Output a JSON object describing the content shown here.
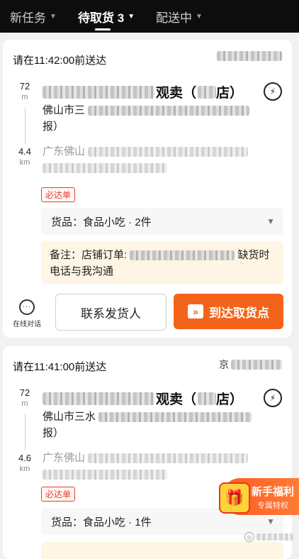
{
  "tabs": [
    {
      "label": "新任务"
    },
    {
      "label": "待取货 3"
    },
    {
      "label": "配送中"
    }
  ],
  "orders": [
    {
      "deadline": "请在11:42:00前送达",
      "store_dist_value": "72",
      "store_dist_unit": "m",
      "store_name_visible": "观卖（",
      "store_name_tail": "店）",
      "store_address_line1": "佛山市三",
      "store_address_line2": "报）",
      "customer_dist_value": "4.4",
      "customer_dist_unit": "km",
      "customer_address_prefix": "广东佛山",
      "tag": "必达单",
      "goods": "货品：食品小吃 · 2件",
      "note_prefix": "备注：店铺订单:",
      "note_suffix": "缺货时",
      "note_line2": "电话与我沟通",
      "chat_label": "在线对话",
      "contact_button": "联系发货人",
      "arrive_button": "到达取货点"
    },
    {
      "deadline": "请在11:41:00前送达",
      "order_prefix": "京",
      "store_dist_value": "72",
      "store_dist_unit": "m",
      "store_name_visible": "观卖（",
      "store_name_tail": "店）",
      "store_address_line1": "佛山市三水",
      "store_address_line2": "报）",
      "customer_dist_value": "4.6",
      "customer_dist_unit": "km",
      "customer_address_prefix": "广东佛山",
      "tag": "必达单",
      "goods": "货品：食品小吃 · 1件"
    }
  ],
  "promo": {
    "title": "新手福利",
    "subtitle": "专属特权"
  },
  "icons": {
    "tab_caret": "chevron-down-icon",
    "navigate": "navigation-icon",
    "goods_expand": "chevron-down-icon",
    "chat": "chat-bubble-icon",
    "arrive": "double-chevron-right-icon",
    "gift": "gift-box-icon"
  },
  "colors": {
    "accent": "#f3641a",
    "tag_red": "#e5402a",
    "note_bg": "#fef5e4",
    "topbar": "#0d0d0d"
  }
}
